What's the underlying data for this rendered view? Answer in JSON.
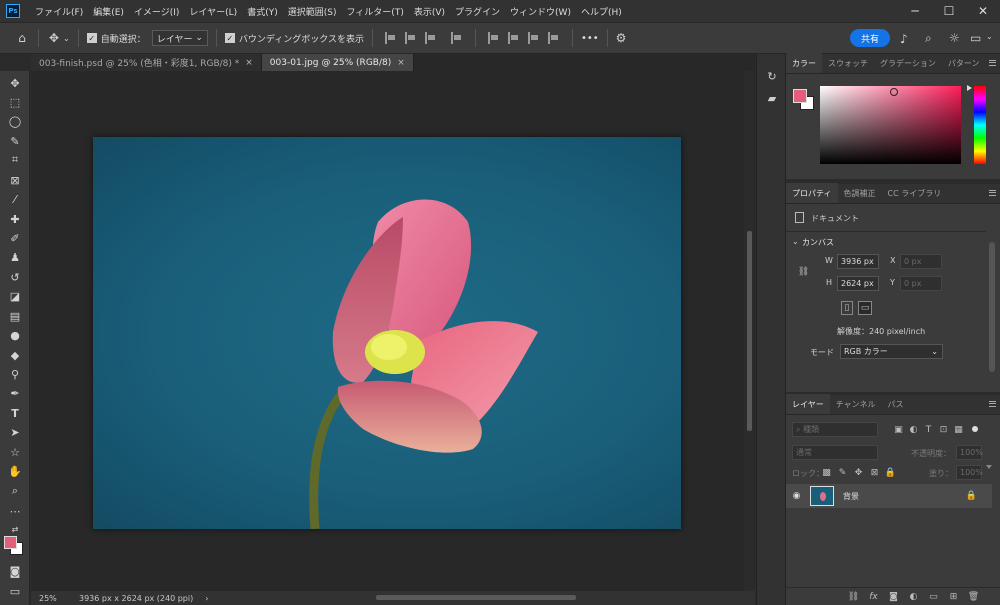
{
  "menu": {
    "logo": "Ps",
    "items": [
      "ファイル(F)",
      "編集(E)",
      "イメージ(I)",
      "レイヤー(L)",
      "書式(Y)",
      "選択範囲(S)",
      "フィルター(T)",
      "表示(V)",
      "プラグイン",
      "ウィンドウ(W)",
      "ヘルプ(H)"
    ]
  },
  "options": {
    "auto_select_label": "自動選択：",
    "auto_select_value": "レイヤー",
    "bbox_label": "バウンディングボックスを表示",
    "more": "•••",
    "share_label": "共有"
  },
  "tabs": [
    {
      "label": "003-finish.psd @ 25% (色相・彩度1, RGB/8) *",
      "close": "×"
    },
    {
      "label": "003-01.jpg @ 25% (RGB/8)",
      "close": "×"
    }
  ],
  "status": {
    "zoom": "25%",
    "doc_info": "3936 px x 2624 px (240 ppi)",
    "arrow": "›"
  },
  "color_panel": {
    "tabs": [
      "カラー",
      "スウォッチ",
      "グラデーション",
      "パターン"
    ],
    "foreground": "#e0607a",
    "background": "#ffffff",
    "hue": "#ff1e5a"
  },
  "properties_panel": {
    "tabs": [
      "プロパティ",
      "色調補正",
      "CC ライブラリ"
    ],
    "doc_label": "ドキュメント",
    "section": "カンバス",
    "w_label": "W",
    "w_value": "3936 px",
    "h_label": "H",
    "h_value": "2624 px",
    "x_label": "X",
    "x_value": "0 px",
    "y_label": "Y",
    "y_value": "0 px",
    "resolution": "解像度：240 pixel/inch",
    "mode_label": "モード",
    "mode_value": "RGB カラー"
  },
  "layers_panel": {
    "tabs": [
      "レイヤー",
      "チャンネル",
      "パス"
    ],
    "filter_label": "種類",
    "blend_mode": "通常",
    "opacity_label": "不透明度：",
    "opacity_value": "100%",
    "lock_label": "ロック：",
    "fill_label": "塗り：",
    "fill_value": "100%",
    "layer_name": "背景"
  }
}
